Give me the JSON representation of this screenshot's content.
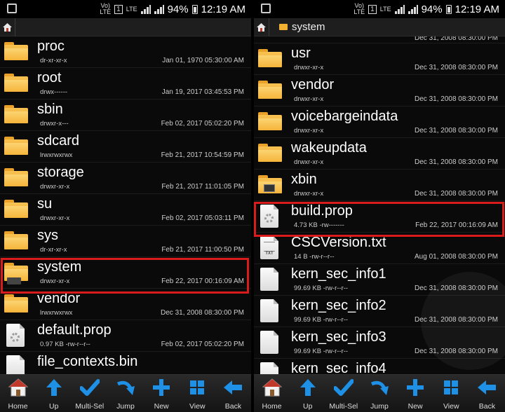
{
  "status": {
    "battery": "94%",
    "time": "12:19 AM",
    "network": "LTE",
    "volte": "Vo) LTE"
  },
  "left": {
    "files": [
      {
        "name": "proc",
        "perm": "dr-xr-xr-x",
        "date": "Jan 01, 1970 05:30:00 AM"
      },
      {
        "name": "root",
        "perm": "drwx------",
        "date": "Jan 19, 2017 03:45:53 PM"
      },
      {
        "name": "sbin",
        "perm": "drwxr-x---",
        "date": "Feb 02, 2017 05:02:20 PM"
      },
      {
        "name": "sdcard",
        "perm": "lrwxrwxrwx",
        "date": "Feb 21, 2017 10:54:59 PM"
      },
      {
        "name": "storage",
        "perm": "drwxr-xr-x",
        "date": "Feb 21, 2017 11:01:05 PM"
      },
      {
        "name": "su",
        "perm": "drwxr-xr-x",
        "date": "Feb 02, 2017 05:03:11 PM"
      },
      {
        "name": "sys",
        "perm": "dr-xr-xr-x",
        "date": "Feb 21, 2017 11:00:50 PM"
      },
      {
        "name": "system",
        "perm": "drwxr-xr-x",
        "date": "Feb 22, 2017 00:16:09 AM"
      },
      {
        "name": "vendor",
        "perm": "lrwxrwxrwx",
        "date": "Dec 31, 2008 08:30:00 PM"
      },
      {
        "name": "default.prop",
        "perm": "0.97 KB -rw-r--r--",
        "date": "Feb 02, 2017 05:02:20 PM"
      },
      {
        "name": "file_contexts.bin",
        "perm": "",
        "date": ""
      }
    ]
  },
  "right": {
    "path_label": "system",
    "partial_top": {
      "date": "Dec 31, 2008 08:30:00 PM"
    },
    "files": [
      {
        "name": "usr",
        "perm": "drwxr-xr-x",
        "date": "Dec 31, 2008 08:30:00 PM"
      },
      {
        "name": "vendor",
        "perm": "drwxr-xr-x",
        "date": "Dec 31, 2008 08:30:00 PM"
      },
      {
        "name": "voicebargeindata",
        "perm": "drwxr-xr-x",
        "date": "Dec 31, 2008 08:30:00 PM"
      },
      {
        "name": "wakeupdata",
        "perm": "drwxr-xr-x",
        "date": "Dec 31, 2008 08:30:00 PM"
      },
      {
        "name": "xbin",
        "perm": "drwxr-xr-x",
        "date": "Dec 31, 2008 08:30:00 PM"
      },
      {
        "name": "build.prop",
        "perm": "4.73 KB -rw-------",
        "date": "Feb 22, 2017 00:16:09 AM"
      },
      {
        "name": "CSCVersion.txt",
        "perm": "14 B -rw-r--r--",
        "date": "Aug 01, 2008 08:30:00 PM"
      },
      {
        "name": "kern_sec_info1",
        "perm": "99.69 KB -rw-r--r--",
        "date": "Dec 31, 2008 08:30:00 PM"
      },
      {
        "name": "kern_sec_info2",
        "perm": "99.69 KB -rw-r--r--",
        "date": "Dec 31, 2008 08:30:00 PM"
      },
      {
        "name": "kern_sec_info3",
        "perm": "99.69 KB -rw-r--r--",
        "date": "Dec 31, 2008 08:30:00 PM"
      },
      {
        "name": "kern_sec_info4",
        "perm": "",
        "date": ""
      }
    ]
  },
  "toolbar": {
    "home": "Home",
    "up": "Up",
    "multisel": "Multi-Sel",
    "jump": "Jump",
    "new": "New",
    "view": "View",
    "back": "Back"
  },
  "colors": {
    "highlight": "#d91b1b",
    "folder": "#f5b43a",
    "toolbar_icon": "#1e90e6"
  }
}
